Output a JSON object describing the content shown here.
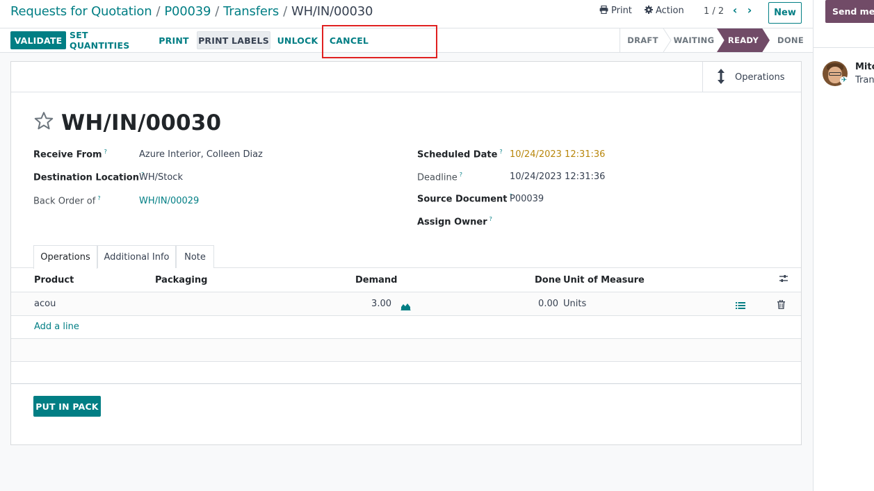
{
  "breadcrumb": {
    "items": [
      "Requests for Quotation",
      "P00039",
      "Transfers"
    ],
    "current": "WH/IN/00030"
  },
  "top_actions": {
    "print_label": "Print",
    "action_label": "Action",
    "pager": "1 / 2",
    "new_label": "New"
  },
  "statusbar": {
    "validate": "VALIDATE",
    "set_quantities": "SET QUANTITIES",
    "print": "PRINT",
    "print_labels": "PRINT LABELS",
    "unlock": "UNLOCK",
    "cancel": "CANCEL",
    "stages": [
      "DRAFT",
      "WAITING",
      "READY",
      "DONE"
    ],
    "active_stage": "READY"
  },
  "smart_button": {
    "label": "Operations",
    "icon": "arrows-v-icon"
  },
  "record": {
    "title": "WH/IN/00030",
    "fields_left": [
      {
        "label": "Receive From",
        "value": "Azure Interior, Colleen Diaz"
      },
      {
        "label": "Destination Location",
        "value": "WH/Stock"
      },
      {
        "label": "Back Order of",
        "value": "WH/IN/00029"
      }
    ],
    "fields_right": [
      {
        "label": "Scheduled Date",
        "value": "10/24/2023 12:31:36"
      },
      {
        "label": "Deadline",
        "value": "10/24/2023 12:31:36"
      },
      {
        "label": "Source Document",
        "value": "P00039"
      },
      {
        "label": "Assign Owner",
        "value": ""
      }
    ],
    "help_mark": "?"
  },
  "tabs": [
    "Operations",
    "Additional Info",
    "Note"
  ],
  "table": {
    "columns": [
      "Product",
      "Packaging",
      "Demand",
      "Done",
      "Unit of Measure"
    ],
    "rows": [
      {
        "product": "acou",
        "packaging": "",
        "demand": "3.00",
        "done": "0.00",
        "uom": "Units"
      }
    ],
    "add_line": "Add a line"
  },
  "put_in_pack": "PUT IN PACK",
  "chatter": {
    "send_message": "Send message",
    "author": "Mitchell Admin",
    "body": "Transfer created"
  },
  "colors": {
    "primary": "#017e84",
    "brand": "#714b67",
    "highlight": "#e02020"
  }
}
